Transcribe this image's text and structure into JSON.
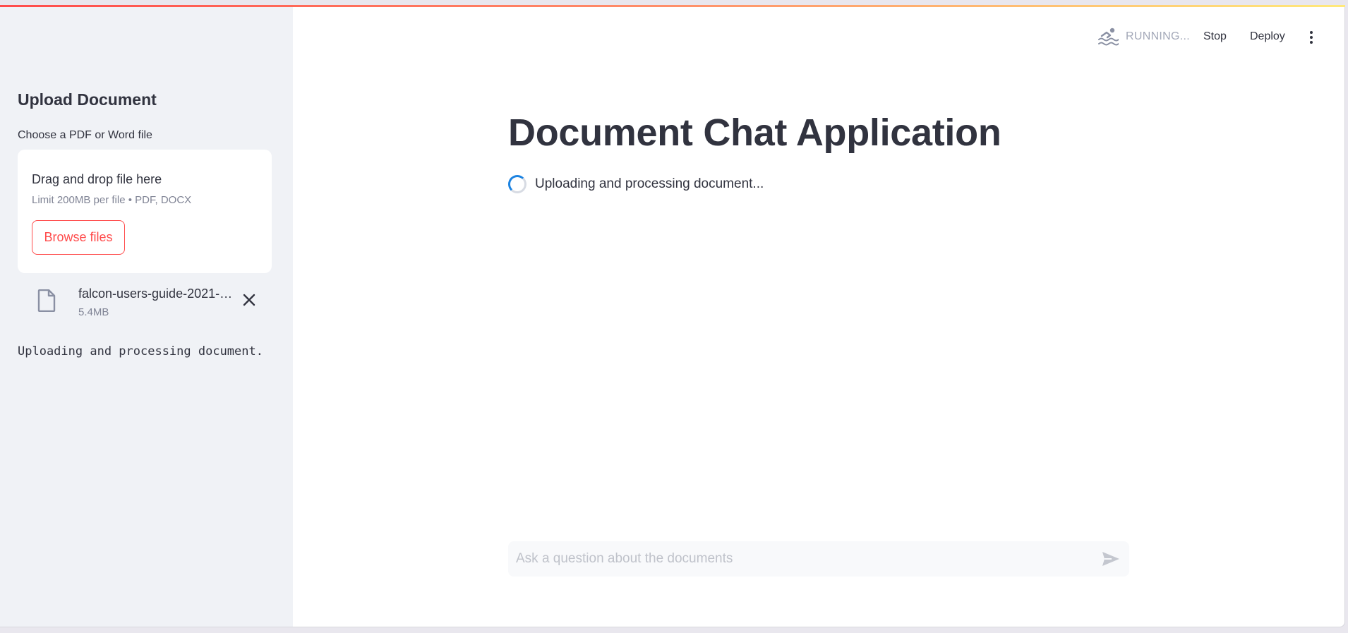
{
  "sidebar": {
    "title": "Upload Document",
    "uploader_label": "Choose a PDF or Word file",
    "dropzone": {
      "title": "Drag and drop file here",
      "limit": "Limit 200MB per file • PDF, DOCX",
      "browse_label": "Browse files"
    },
    "file": {
      "name": "falcon-users-guide-2021-…",
      "size": "5.4MB"
    },
    "status_text": "Uploading and processing document."
  },
  "header": {
    "status": "RUNNING...",
    "status_icon": "swimming-icon",
    "stop_label": "Stop",
    "deploy_label": "Deploy",
    "menu_icon": "kebab-menu-icon"
  },
  "main": {
    "title": "Document Chat Application",
    "spinner_text": "Uploading and processing document..."
  },
  "chat": {
    "placeholder": "Ask a question about the documents",
    "value": ""
  },
  "colors": {
    "accent": "#ff4b4b",
    "spinner": "#1c83e1",
    "sidebar_bg": "#f0f2f6",
    "text": "#31333f",
    "muted": "#808495"
  }
}
